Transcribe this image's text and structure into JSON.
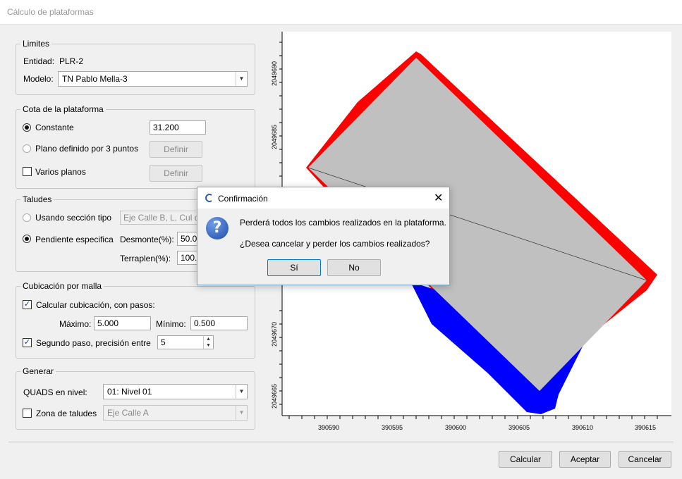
{
  "window": {
    "title": "Cálculo de plataformas"
  },
  "limites": {
    "legend": "Limites",
    "entidad_label": "Entidad:",
    "entidad_value": "PLR-2",
    "modelo_label": "Modelo:",
    "modelo_value": "TN Pablo Mella-3"
  },
  "cota": {
    "legend": "Cota de la plataforma",
    "constante_label": "Constante",
    "constante_value": "31.200",
    "plano_label": "Plano definido por 3 puntos",
    "definir_1": "Definir",
    "varios_label": "Varios planos",
    "definir_2": "Definir"
  },
  "taludes": {
    "legend": "Taludes",
    "seccion_label": "Usando sección tipo",
    "seccion_value": "Eje Calle B, L, Cul de",
    "pendiente_label": "Pendiente especifica",
    "desmonte_label": "Desmonte(%):",
    "desmonte_value": "50.00",
    "terraplen_label": "Terraplen(%):",
    "terraplen_value": "100.0"
  },
  "cubicacion": {
    "legend": "Cubicación por malla",
    "calcular_label": "Calcular cubicación, con pasos:",
    "maximo_label": "Máximo:",
    "maximo_value": "5.000",
    "minimo_label": "Mínimo:",
    "minimo_value": "0.500",
    "segundo_label": "Segundo paso, precisión entre",
    "segundo_value": "5"
  },
  "generar": {
    "legend": "Generar",
    "quads_label": "QUADS en nivel:",
    "quads_value": "01: Nivel 01",
    "zona_label": "Zona de taludes",
    "zona_value": "Eje Calle A"
  },
  "plot": {
    "y_ticks": [
      "2049690",
      "2049685",
      "2049670",
      "2049665"
    ],
    "x_ticks": [
      "390590",
      "390595",
      "390600",
      "390605",
      "390610",
      "390615"
    ],
    "colors": {
      "fill": "#c0c0c0",
      "cut": "#ff0000",
      "fill_slope": "#0000ff"
    }
  },
  "buttons": {
    "calcular": "Calcular",
    "aceptar": "Aceptar",
    "cancelar": "Cancelar"
  },
  "dialog": {
    "title": "Confirmación",
    "line1": "Perderá todos los cambios realizados en la plataforma.",
    "line2": "¿Desea cancelar y perder los cambios realizados?",
    "yes": "Sí",
    "no": "No"
  }
}
